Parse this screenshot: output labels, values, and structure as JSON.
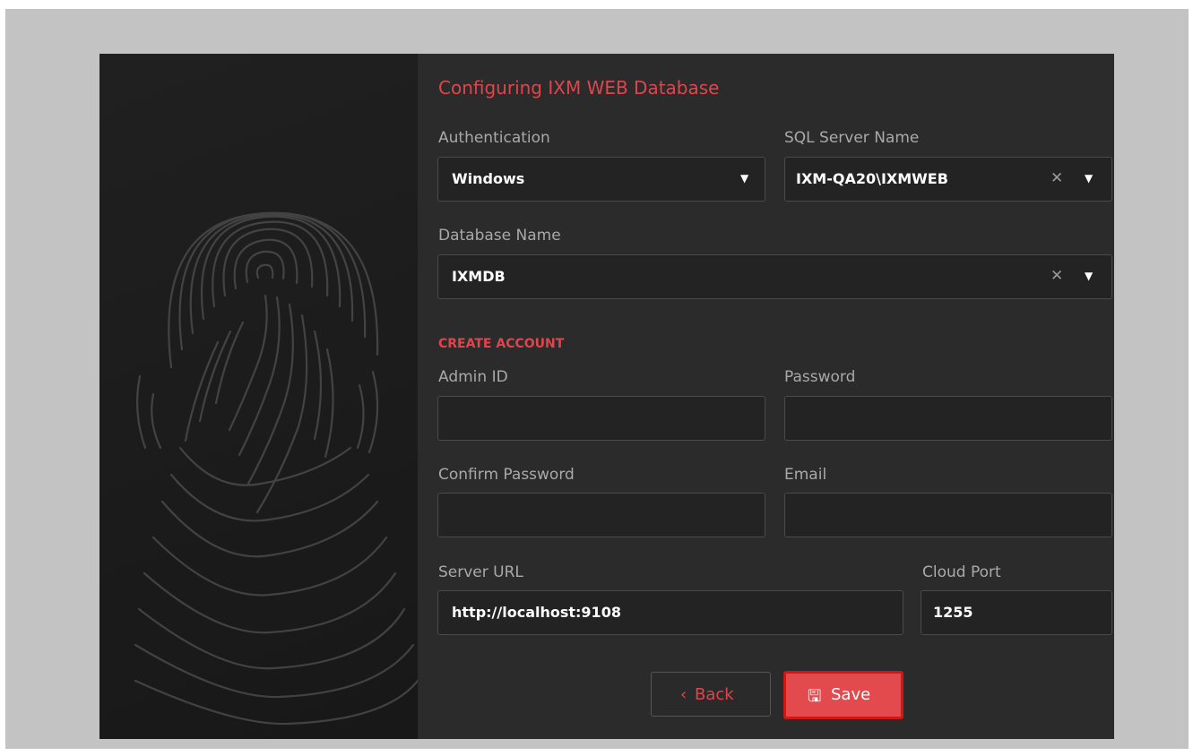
{
  "title": "Configuring IXM WEB Database",
  "auth": {
    "label": "Authentication",
    "value": "Windows"
  },
  "sql": {
    "label": "SQL Server Name",
    "value": "IXM-QA20\\IXMWEB"
  },
  "db": {
    "label": "Database Name",
    "value": "IXMDB"
  },
  "section": "CREATE ACCOUNT",
  "admin": {
    "label": "Admin ID",
    "value": ""
  },
  "password": {
    "label": "Password",
    "value": ""
  },
  "confirm": {
    "label": "Confirm Password",
    "value": ""
  },
  "email": {
    "label": "Email",
    "value": ""
  },
  "server_url": {
    "label": "Server URL",
    "value": "http://localhost:9108"
  },
  "cloud_port": {
    "label": "Cloud Port",
    "value": "1255"
  },
  "buttons": {
    "back_icon": "‹",
    "back": "Back",
    "save_icon": "🖫",
    "save": "Save"
  },
  "icons": {
    "dropdown": "chevron-down-icon",
    "clear": "clear-icon",
    "save": "floppy-disk-icon",
    "back": "chevron-left-icon",
    "fingerprint": "fingerprint-head-illustration"
  },
  "colors": {
    "accent": "#e0454b",
    "save_bg": "#e34a4e",
    "save_border": "#d11616",
    "panel": "#2b2b2b"
  }
}
